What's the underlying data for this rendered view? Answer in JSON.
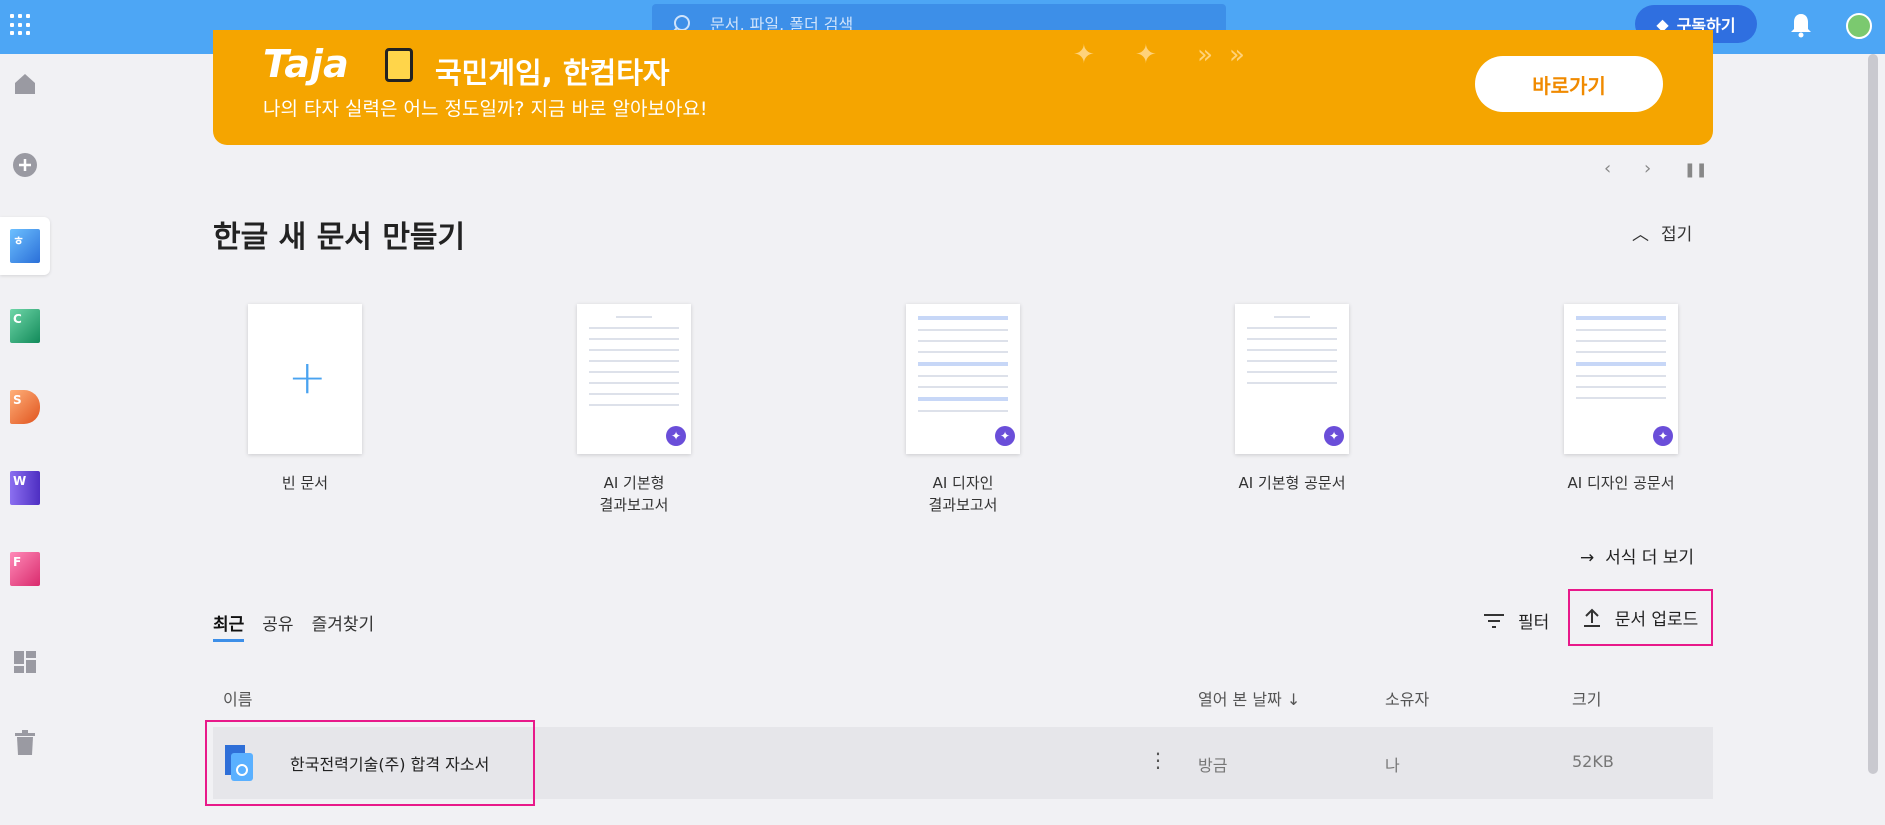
{
  "topbar": {
    "search_placeholder": "문서, 파일, 폴더 검색",
    "subscribe_label": "구독하기"
  },
  "sidebar": {
    "items": [
      {
        "name": "home"
      },
      {
        "name": "create"
      },
      {
        "name": "hangul",
        "letter": "",
        "color": "#3d8fe8"
      },
      {
        "name": "hancell",
        "letter": "C",
        "color": "#1e9e6a"
      },
      {
        "name": "hanshow",
        "letter": "S",
        "color": "#ea6a2c"
      },
      {
        "name": "hanword",
        "letter": "W",
        "color": "#6a4ed9"
      },
      {
        "name": "hanform",
        "letter": "F",
        "color": "#e54b8a"
      },
      {
        "name": "dashboard"
      },
      {
        "name": "trash"
      }
    ]
  },
  "banner": {
    "brand": "Taja",
    "title": "국민게임, 한컴타자",
    "subtitle": "나의 타자 실력은 어느 정도일까? 지금 바로 알아보아요!",
    "button_label": "바로가기"
  },
  "new_doc": {
    "title": "한글 새 문서 만들기",
    "collapse_label": "접기",
    "templates": [
      {
        "label": "빈 문서",
        "type": "blank"
      },
      {
        "label": "AI 기본형\n결과보고서",
        "type": "ai"
      },
      {
        "label": "AI 디자인\n결과보고서",
        "type": "ai"
      },
      {
        "label": "AI 기본형 공문서",
        "type": "ai"
      },
      {
        "label": "AI 디자인 공문서",
        "type": "ai"
      }
    ],
    "more_label": "서식 더 보기"
  },
  "tabs": [
    "최근",
    "공유",
    "즐겨찾기"
  ],
  "toolbar": {
    "filter_label": "필터",
    "upload_label": "문서 업로드"
  },
  "table": {
    "headers": {
      "name": "이름",
      "opened": "열어 본 날짜",
      "owner": "소유자",
      "size": "크기"
    },
    "rows": [
      {
        "name": "한국전력기술(주) 합격 자소서",
        "opened": "방금",
        "owner": "나",
        "size": "52KB"
      }
    ]
  },
  "colors": {
    "topbar": "#4da6f5",
    "banner": "#f5a500",
    "highlight": "#e8198a"
  }
}
